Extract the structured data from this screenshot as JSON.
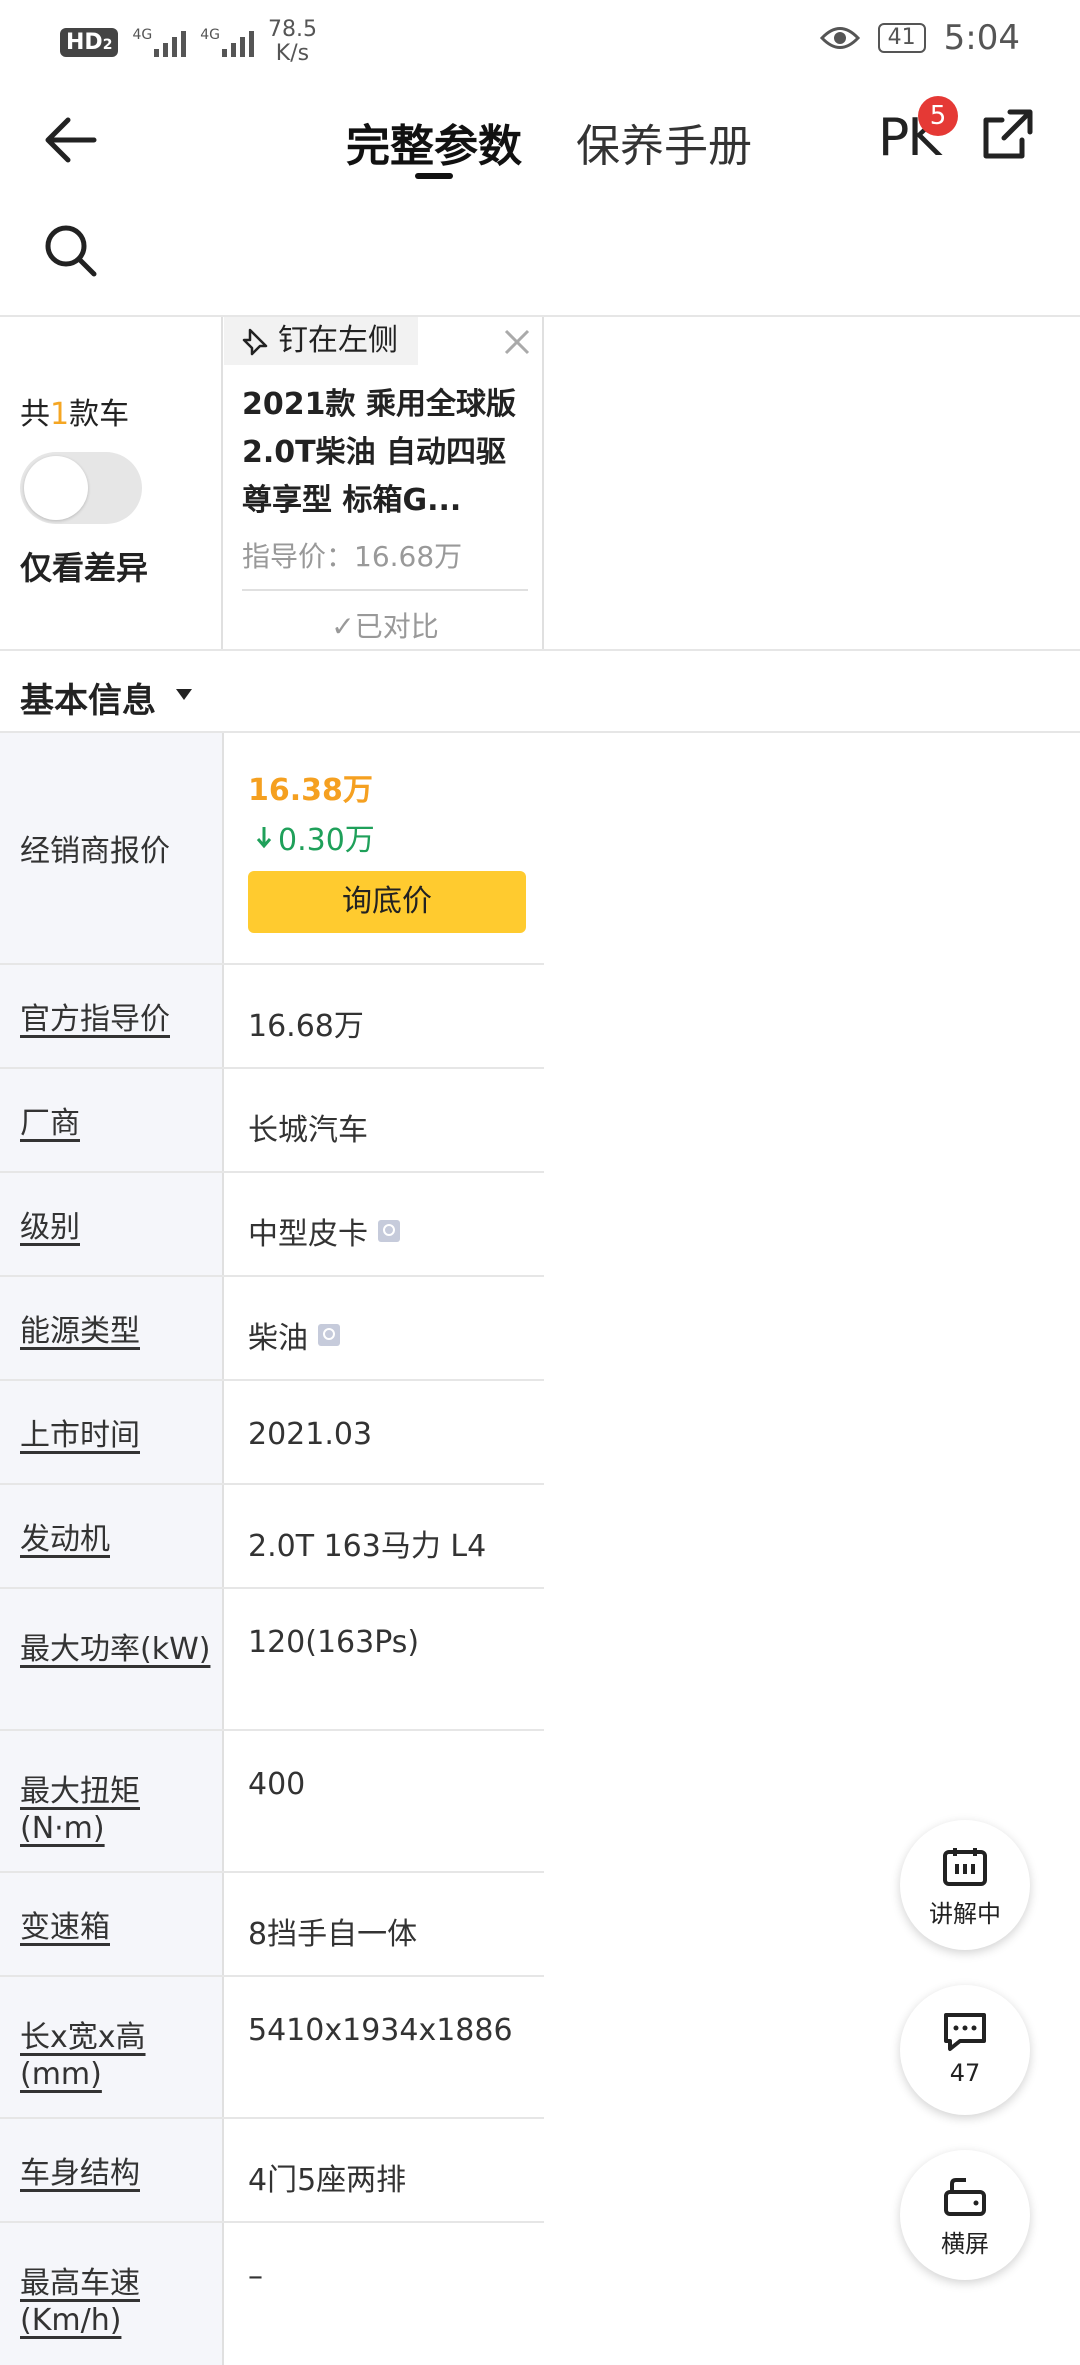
{
  "status_bar": {
    "network_badge": "HD",
    "network_badge_sub": "2",
    "signal1": "4G",
    "signal2": "4G",
    "speed_value": "78.5",
    "speed_unit": "K/s",
    "battery": "41",
    "time": "5:04"
  },
  "nav": {
    "tab_active": "完整参数",
    "tab_inactive": "保养手册",
    "pk_label": "PK",
    "pk_badge": "5"
  },
  "car_header": {
    "count_prefix": "共",
    "count_num": "1",
    "count_suffix": "款车",
    "only_diff_label": "仅看差异",
    "pin_label": "钉在左侧",
    "car_name": "2021款 乘用全球版 2.0T柴油 自动四驱尊享型 标箱G...",
    "guide_price": "指导价：16.68万",
    "compared_label": "已对比"
  },
  "section": {
    "title": "基本信息"
  },
  "dealer_row": {
    "label": "经销商报价",
    "price": "16.38万",
    "drop": "0.30万",
    "ask_button": "询底价"
  },
  "spec_rows": [
    {
      "label": "官方指导价",
      "value": "16.68万"
    },
    {
      "label": "厂商",
      "value": "长城汽车"
    },
    {
      "label": "级别",
      "value": "中型皮卡"
    },
    {
      "label": "能源类型",
      "value": "柴油"
    },
    {
      "label": "上市时间",
      "value": "2021.03"
    },
    {
      "label": "发动机",
      "value": "2.0T 163马力 L4"
    },
    {
      "label": "最大功率(kW)",
      "value": "120(163Ps)"
    },
    {
      "label": "最大扭矩(N·m)",
      "value": "400"
    },
    {
      "label": "变速箱",
      "value": "8挡手自一体"
    },
    {
      "label": "长x宽x高(mm)",
      "value": "5410x1934x1886"
    },
    {
      "label": "车身结构",
      "value": "4门5座两排"
    },
    {
      "label": "最高车速(Km/h)",
      "value": "–"
    }
  ],
  "fabs": {
    "explain_label": "讲解中",
    "comments_count": "47",
    "landscape_label": "横屏"
  },
  "colors": {
    "accent_yellow": "#ffcb2f",
    "price_orange": "#f5a020",
    "drop_green": "#1fa05a",
    "badge_red": "#e53935"
  }
}
